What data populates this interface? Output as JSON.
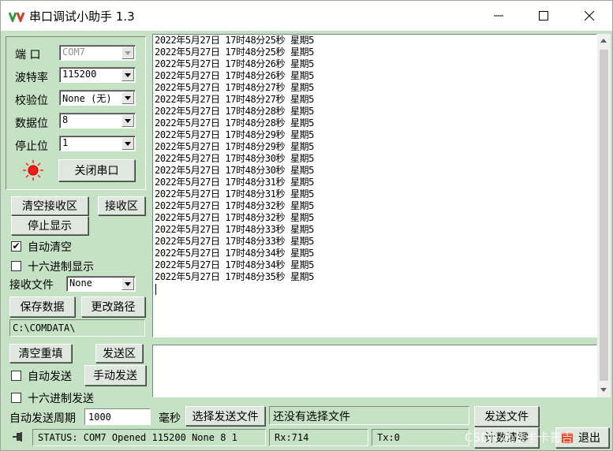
{
  "window": {
    "title": "串口调试小助手 1.3"
  },
  "settings": {
    "port_label": "端  口",
    "port_value": "COM7",
    "baud_label": "波特率",
    "baud_value": "115200",
    "parity_label": "校验位",
    "parity_value": "None (无)",
    "databits_label": "数据位",
    "databits_value": "8",
    "stopbits_label": "停止位",
    "stopbits_value": "1",
    "close_port_button": "关闭串口",
    "led_color": "#ff1a1a"
  },
  "receive": {
    "clear_button": "清空接收区",
    "area_button": "接收区",
    "stop_display_button": "停止显示",
    "auto_clear_label": "自动清空",
    "auto_clear_checked": true,
    "hex_display_label": "十六进制显示",
    "hex_display_checked": false,
    "file_label": "接收文件",
    "file_value": "None",
    "save_button": "保存数据",
    "change_path_button": "更改路径",
    "path": "C:\\COMDATA\\",
    "lines": [
      "2022年5月27日 17时48分25秒 星期5",
      "2022年5月27日 17时48分25秒 星期5",
      "2022年5月27日 17时48分26秒 星期5",
      "2022年5月27日 17时48分26秒 星期5",
      "2022年5月27日 17时48分27秒 星期5",
      "2022年5月27日 17时48分27秒 星期5",
      "2022年5月27日 17时48分28秒 星期5",
      "2022年5月27日 17时48分28秒 星期5",
      "2022年5月27日 17时48分29秒 星期5",
      "2022年5月27日 17时48分29秒 星期5",
      "2022年5月27日 17时48分30秒 星期5",
      "2022年5月27日 17时48分30秒 星期5",
      "2022年5月27日 17时48分31秒 星期5",
      "2022年5月27日 17时48分31秒 星期5",
      "2022年5月27日 17时48分32秒 星期5",
      "2022年5月27日 17时48分32秒 星期5",
      "2022年5月27日 17时48分33秒 星期5",
      "2022年5月27日 17时48分33秒 星期5",
      "2022年5月27日 17时48分34秒 星期5",
      "2022年5月27日 17时48分34秒 星期5",
      "2022年5月27日 17时48分35秒 星期5"
    ]
  },
  "send": {
    "clear_button": "清空重填",
    "area_button": "发送区",
    "auto_send_label": "自动发送",
    "auto_send_checked": false,
    "manual_send_button": "手动发送",
    "hex_send_label": "十六进制发送",
    "hex_send_checked": false,
    "period_label": "自动发送周期",
    "period_value": "1000",
    "ms_label": "毫秒",
    "select_file_button": "选择发送文件",
    "file_status": "还没有选择文件",
    "send_file_button": "发送文件"
  },
  "statusbar": {
    "status_text": "STATUS: COM7 Opened 115200 None  8 1",
    "rx_text": "Rx:714",
    "tx_text": "Tx:0",
    "count_clear_button": "计数清零",
    "exit_button": "退出",
    "watermark": "CSDN @法卡卡普吉"
  }
}
